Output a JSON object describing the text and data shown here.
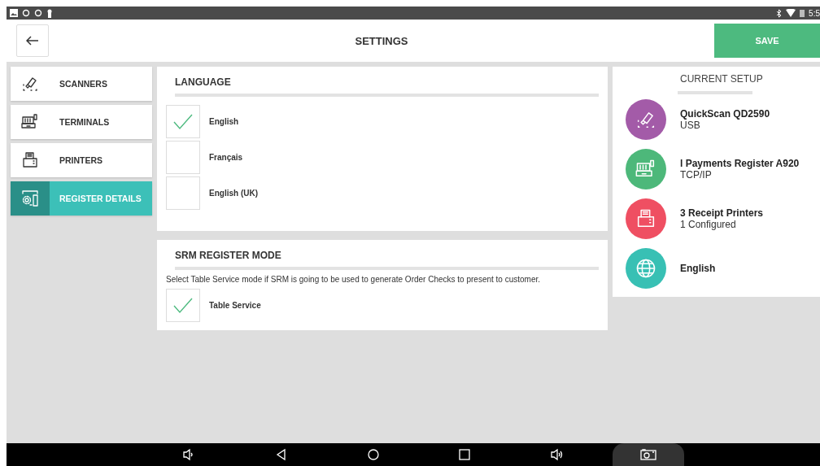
{
  "status_bar": {
    "time": "5:5"
  },
  "header": {
    "title": "SETTINGS",
    "save_button": "SAVE"
  },
  "sidebar": {
    "items": [
      {
        "label": "SCANNERS",
        "kind": "scanner",
        "selected": false
      },
      {
        "label": "TERMINALS",
        "kind": "register",
        "selected": false
      },
      {
        "label": "PRINTERS",
        "kind": "printer",
        "selected": false
      },
      {
        "label": "REGISTER DETAILS",
        "kind": "details",
        "selected": true
      }
    ]
  },
  "language": {
    "title": "LANGUAGE",
    "options": [
      {
        "label": "English",
        "checked": true
      },
      {
        "label": "Français",
        "checked": false
      },
      {
        "label": "English (UK)",
        "checked": false
      }
    ]
  },
  "srm_register_mode": {
    "title": "SRM REGISTER MODE",
    "description": "Select Table Service mode if SRM is going to be used to generate Order Checks to present to customer.",
    "options": [
      {
        "label": "Table Service",
        "checked": true
      }
    ]
  },
  "current_setup": {
    "title": "CURRENT SETUP",
    "items": [
      {
        "kind": "scanner",
        "color": "#a35ba8",
        "name": "QuickScan QD2590",
        "detail": "USB"
      },
      {
        "kind": "register",
        "color": "#4db87a",
        "name": "l Payments Register A920",
        "detail": "TCP/IP"
      },
      {
        "kind": "printer",
        "color": "#ef4f62",
        "name": "3 Receipt Printers",
        "detail": "1 Configured"
      },
      {
        "kind": "globe",
        "color": "#38c0b4",
        "name": "English"
      }
    ]
  }
}
